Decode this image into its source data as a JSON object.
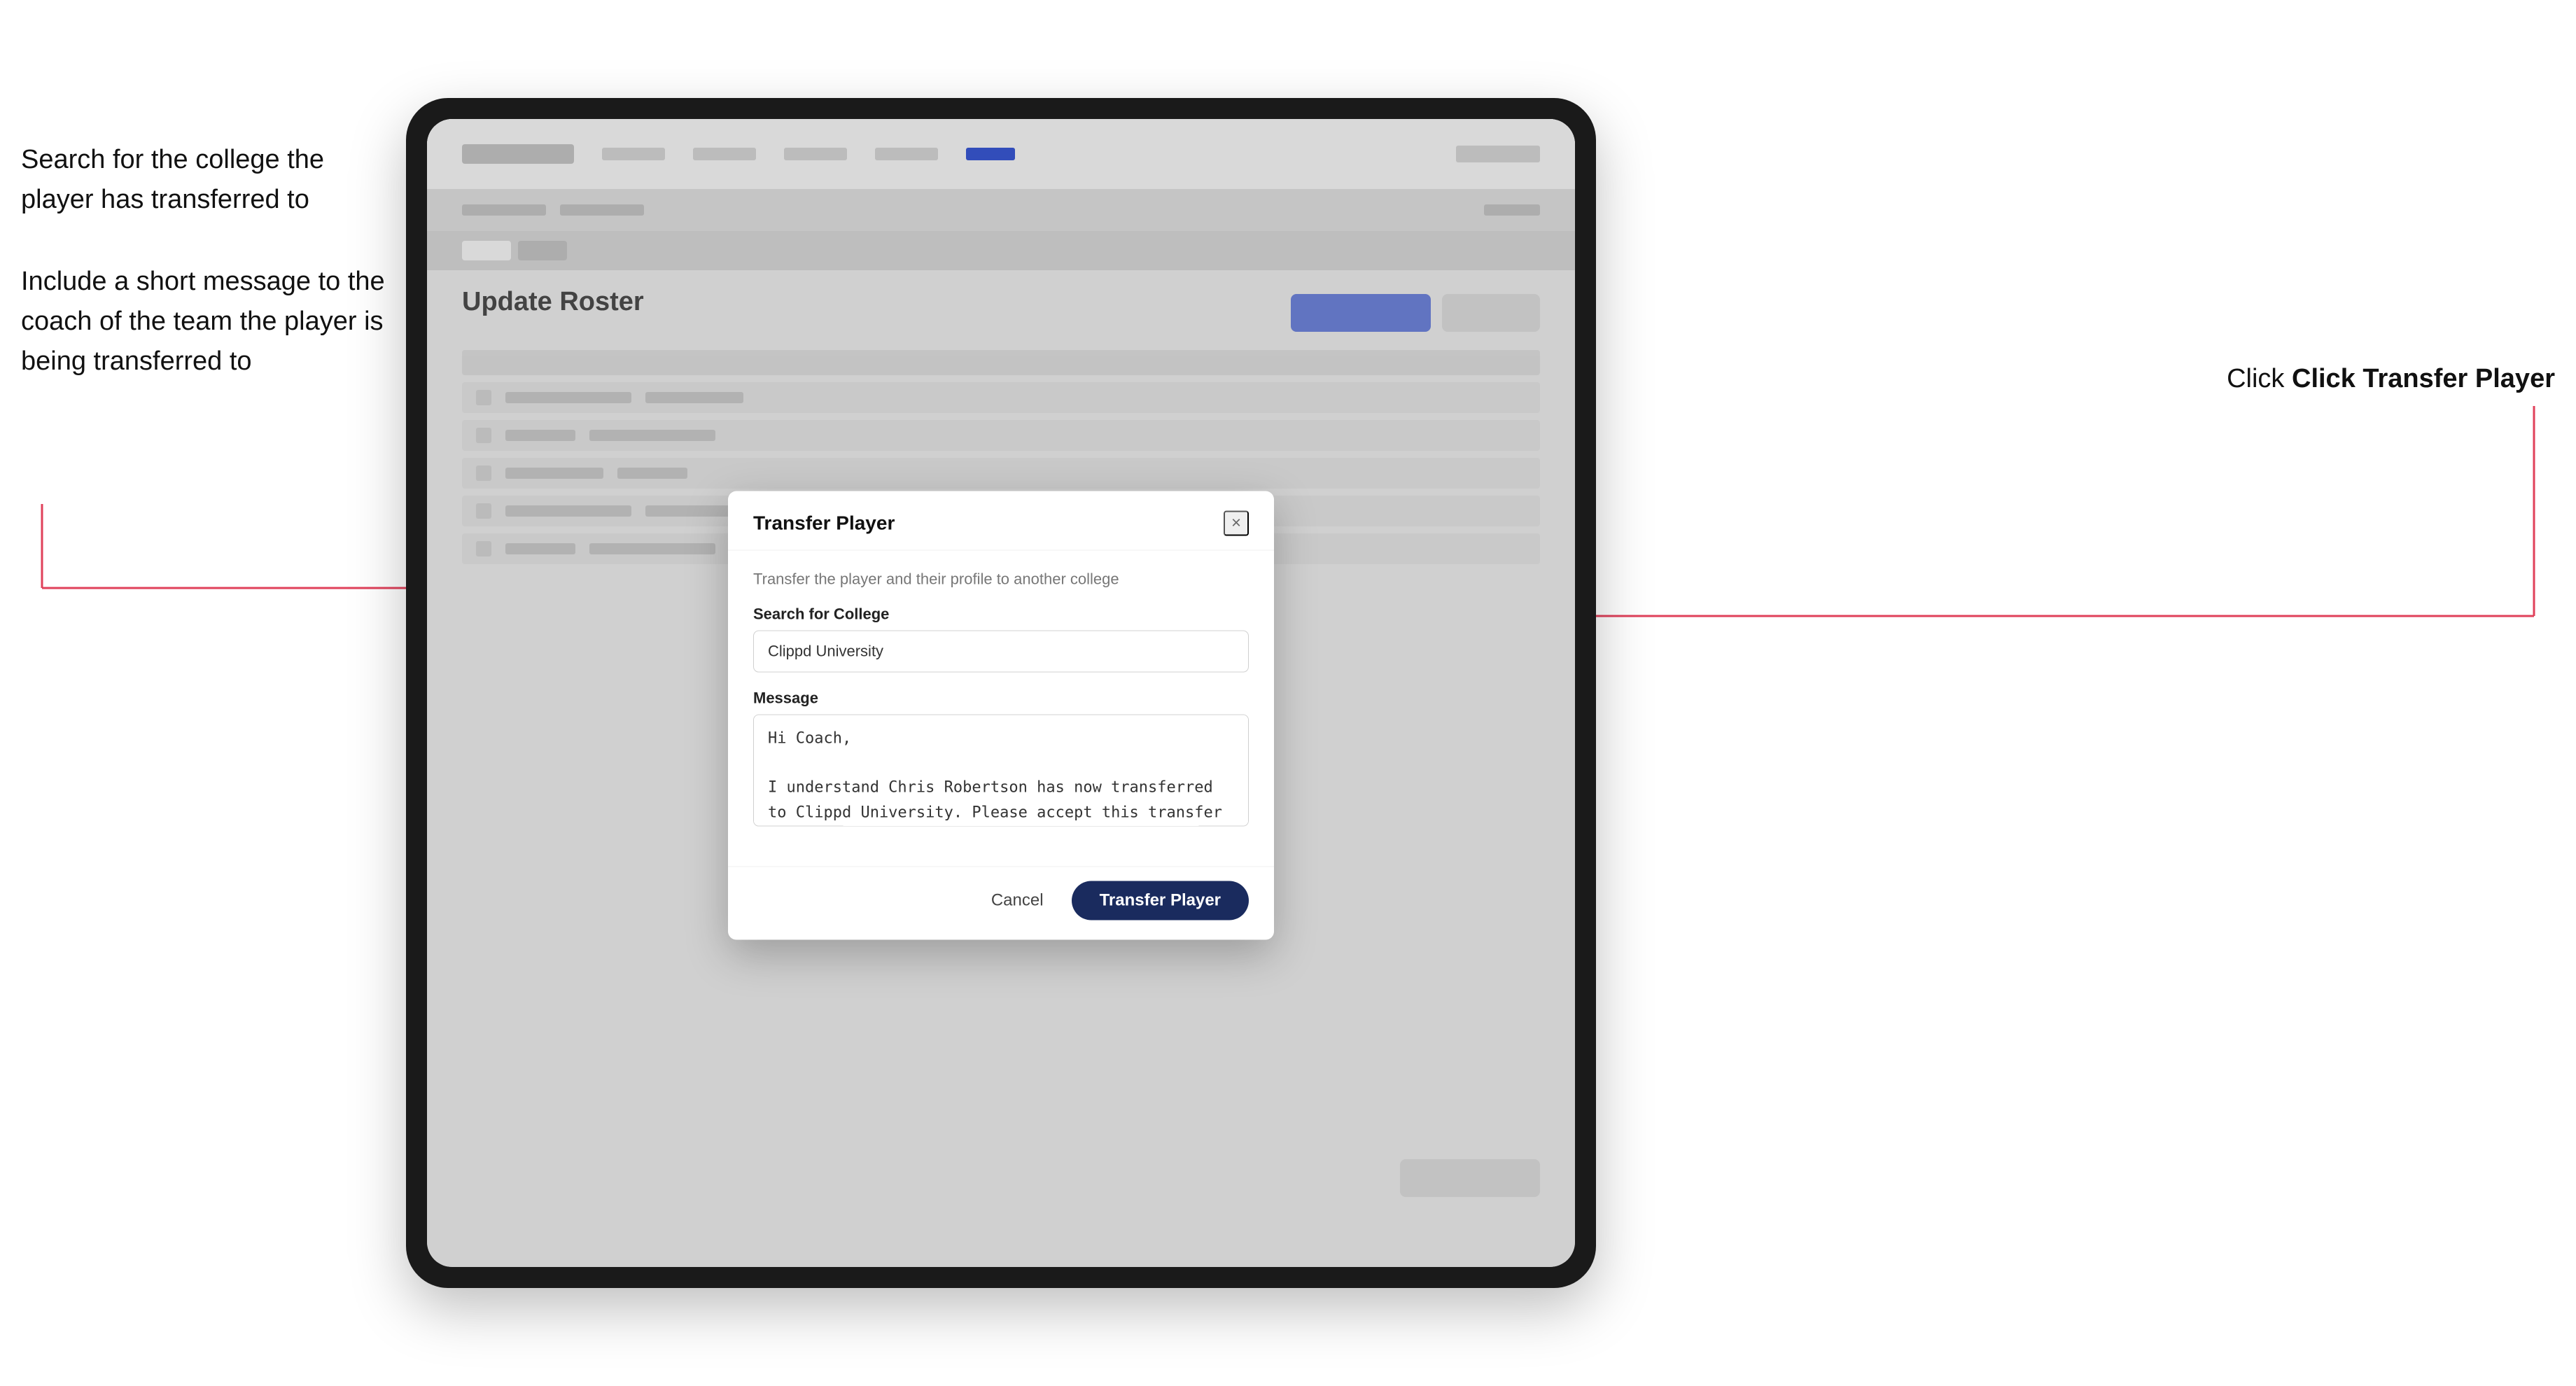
{
  "annotations": {
    "left_top": "Search for the college the player has transferred to",
    "left_bottom": "Include a short message to the coach of the team the player is being transferred to",
    "right": "Click Transfer Player"
  },
  "modal": {
    "title": "Transfer Player",
    "subtitle": "Transfer the player and their profile to another college",
    "college_label": "Search for College",
    "college_value": "Clippd University",
    "message_label": "Message",
    "message_value": "Hi Coach,\n\nI understand Chris Robertson has now transferred to Clippd University. Please accept this transfer request when you can.",
    "cancel_label": "Cancel",
    "transfer_label": "Transfer Player",
    "close_icon": "×"
  },
  "page_title": "Update Roster"
}
